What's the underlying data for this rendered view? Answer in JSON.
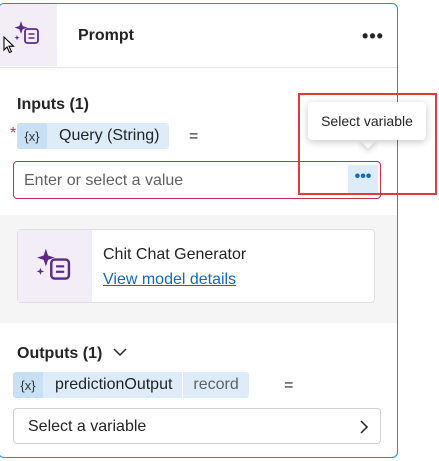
{
  "node": {
    "title": "Prompt",
    "more_label": "•••",
    "icon": "sparkle-prompt-icon"
  },
  "inputs": {
    "label": "Inputs (1)",
    "required_mark": "*",
    "variable_icon": "{x}",
    "variable_label": "Query (String)",
    "equals": "=",
    "value_placeholder": "Enter or select a value",
    "picker_label": "•••"
  },
  "tooltip": {
    "text": "Select variable"
  },
  "model": {
    "name": "Chit Chat Generator",
    "link_text": "View model details",
    "icon": "sparkle-prompt-icon"
  },
  "outputs": {
    "label": "Outputs (1)",
    "variable_icon": "{x}",
    "variable_label": "predictionOutput",
    "type_label": "record",
    "equals": "=",
    "select_label": "Select a variable"
  },
  "colors": {
    "accent": "#0f6cbd",
    "card_border": "#2b88d8",
    "error": "#c4314b",
    "highlight": "#e0393e",
    "chip_bg": "#deecf9",
    "icon_bg": "#f3edf7",
    "icon_purple": "#5b2a86"
  }
}
